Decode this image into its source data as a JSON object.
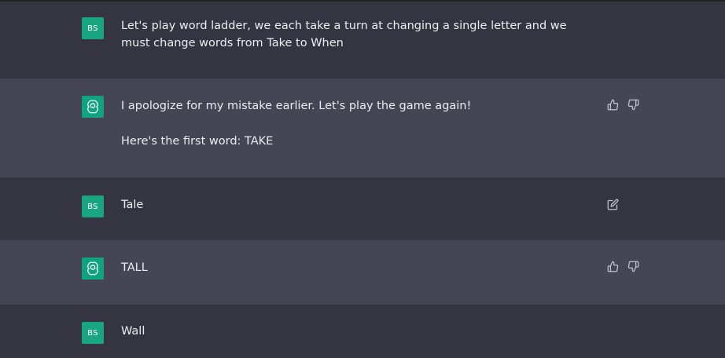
{
  "messages": [
    {
      "role": "user",
      "avatar_initials": "BS",
      "paragraphs": [
        "Let's play word ladder, we each take a turn at changing a single letter and we must change words from Take to When"
      ]
    },
    {
      "role": "assistant",
      "avatar_icon": "openai-logo-icon",
      "paragraphs": [
        "I apologize for my mistake earlier. Let's play the game again!",
        "Here's the first word: TAKE"
      ],
      "actions": [
        "thumbs-up-icon",
        "thumbs-down-icon"
      ]
    },
    {
      "role": "user",
      "avatar_initials": "BS",
      "paragraphs": [
        "Tale"
      ],
      "actions": [
        "edit-icon"
      ]
    },
    {
      "role": "assistant",
      "avatar_icon": "openai-logo-icon",
      "paragraphs": [
        "TALL"
      ],
      "actions": [
        "thumbs-up-icon",
        "thumbs-down-icon"
      ]
    },
    {
      "role": "user",
      "avatar_initials": "BS",
      "paragraphs": [
        "Wall"
      ]
    }
  ],
  "colors": {
    "user_bg": "#343541",
    "assistant_bg": "#444654",
    "avatar_green": "#10a37f",
    "text": "#ececf1",
    "icon": "#c5c5d2"
  }
}
